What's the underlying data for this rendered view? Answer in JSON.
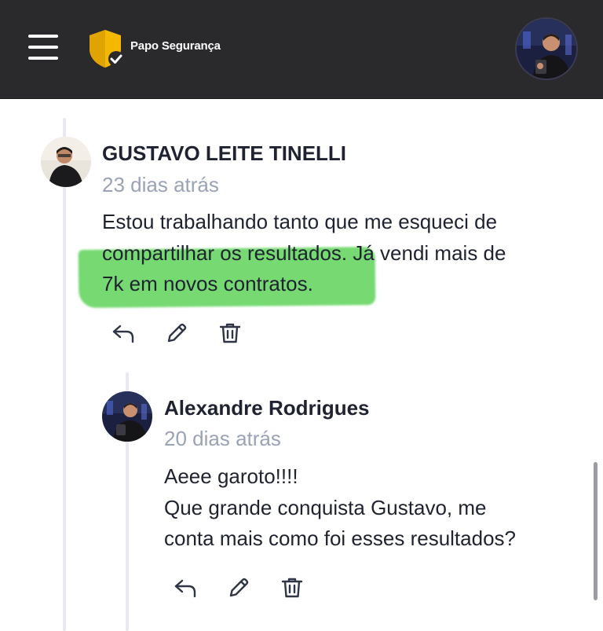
{
  "header": {
    "menu_icon": "hamburger-menu-icon",
    "brand_name": "Papo Segurança",
    "logo_icon": "shield-check-icon",
    "avatar_icon": "user-avatar",
    "brand_color": "#f5b800"
  },
  "comments": [
    {
      "author": "GUSTAVO LEITE TINELLI",
      "time": "23 dias atrás",
      "body_lines": [
        "Estou trabalhando tanto que me esqueci de",
        "compartilhar os resultados. Já vendi mais de",
        "7k em novos contratos."
      ],
      "highlight_color": "#5fd35a",
      "actions": [
        "reply-icon",
        "edit-icon",
        "trash-icon"
      ]
    },
    {
      "author": "Alexandre Rodrigues",
      "time": "20 dias atrás",
      "body_lines": [
        "Aeee garoto!!!!",
        "Que grande conquista Gustavo, me",
        "conta mais como foi esses resultados?"
      ],
      "actions": [
        "reply-icon",
        "edit-icon",
        "trash-icon"
      ]
    }
  ]
}
